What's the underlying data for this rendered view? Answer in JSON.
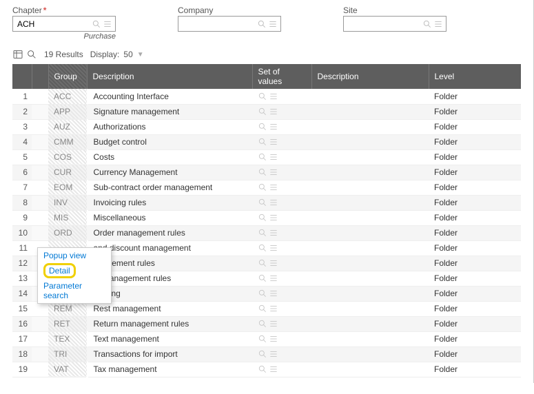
{
  "filters": {
    "chapter": {
      "label": "Chapter",
      "required": true,
      "value": "ACH",
      "sublabel": "Purchase"
    },
    "company": {
      "label": "Company",
      "value": ""
    },
    "site": {
      "label": "Site",
      "value": ""
    }
  },
  "toolbar": {
    "results_text": "19 Results",
    "display_label": "Display:",
    "display_value": "50"
  },
  "columns": {
    "group": "Group",
    "desc1": "Description",
    "sov": "Set of values",
    "desc2": "Description",
    "level": "Level"
  },
  "rows": [
    {
      "n": "1",
      "group": "ACC",
      "desc": "Accounting Interface",
      "level": "Folder"
    },
    {
      "n": "2",
      "group": "APP",
      "desc": "Signature management",
      "level": "Folder"
    },
    {
      "n": "3",
      "group": "AUZ",
      "desc": "Authorizations",
      "level": "Folder"
    },
    {
      "n": "4",
      "group": "CMM",
      "desc": "Budget control",
      "level": "Folder"
    },
    {
      "n": "5",
      "group": "COS",
      "desc": "Costs",
      "level": "Folder"
    },
    {
      "n": "6",
      "group": "CUR",
      "desc": "Currency Management",
      "level": "Folder"
    },
    {
      "n": "7",
      "group": "EOM",
      "desc": "Sub-contract order management",
      "level": "Folder"
    },
    {
      "n": "8",
      "group": "INV",
      "desc": "Invoicing rules",
      "level": "Folder"
    },
    {
      "n": "9",
      "group": "MIS",
      "desc": "Miscellaneous",
      "level": "Folder"
    },
    {
      "n": "10",
      "group": "ORD",
      "desc": "Order management rules",
      "level": "Folder"
    },
    {
      "n": "11",
      "group": "",
      "desc": "and discount management",
      "level": "Folder"
    },
    {
      "n": "12",
      "group": "",
      "desc": "anagement rules",
      "level": "Folder"
    },
    {
      "n": "13",
      "group": "",
      "desc": "pt management rules",
      "level": "Folder"
    },
    {
      "n": "14",
      "group": "",
      "desc": "rencing",
      "level": "Folder"
    },
    {
      "n": "15",
      "group": "REM",
      "desc": "Rest management",
      "level": "Folder"
    },
    {
      "n": "16",
      "group": "RET",
      "desc": "Return management rules",
      "level": "Folder"
    },
    {
      "n": "17",
      "group": "TEX",
      "desc": "Text management",
      "level": "Folder"
    },
    {
      "n": "18",
      "group": "TRI",
      "desc": "Transactions for import",
      "level": "Folder"
    },
    {
      "n": "19",
      "group": "VAT",
      "desc": "Tax management",
      "level": "Folder"
    }
  ],
  "context_menu": {
    "items": [
      {
        "label": "Popup view",
        "highlight": false
      },
      {
        "label": "Detail",
        "highlight": true
      },
      {
        "label": "Parameter search",
        "highlight": false
      }
    ]
  }
}
